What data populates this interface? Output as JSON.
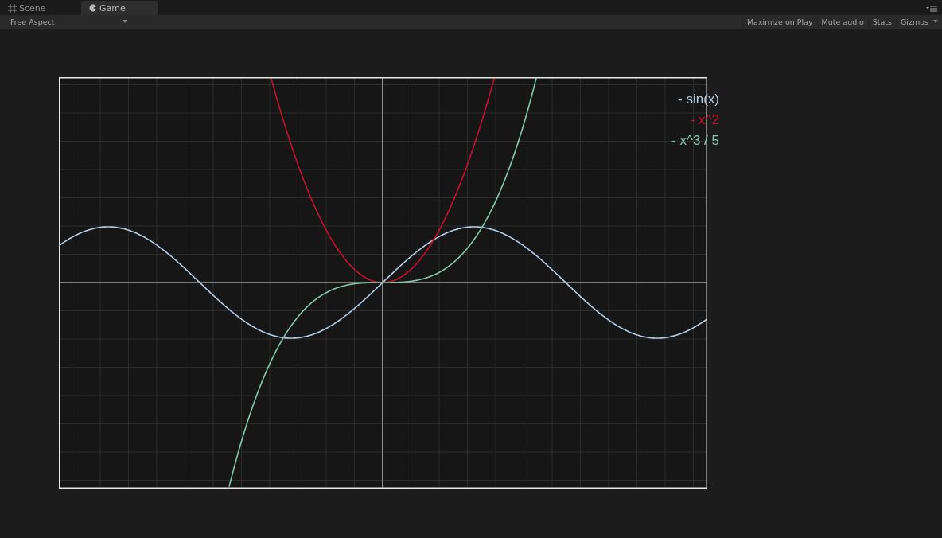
{
  "tabs": [
    {
      "label": "Scene",
      "kind": "scene",
      "selected": false
    },
    {
      "label": "Game",
      "kind": "game",
      "selected": true
    }
  ],
  "toolbar": {
    "aspect": "Free Aspect",
    "buttons": [
      "Maximize on Play",
      "Mute audio",
      "Stats",
      "Gizmos"
    ]
  },
  "plot": {
    "series": [
      {
        "label": "- sin(x)",
        "kind": "sin",
        "color": "#b4cde6"
      },
      {
        "label": "- x^2",
        "kind": "square",
        "color": "#c8102e"
      },
      {
        "label": "- x^3 / 5",
        "kind": "cube",
        "color": "#86c9aa"
      }
    ]
  }
}
